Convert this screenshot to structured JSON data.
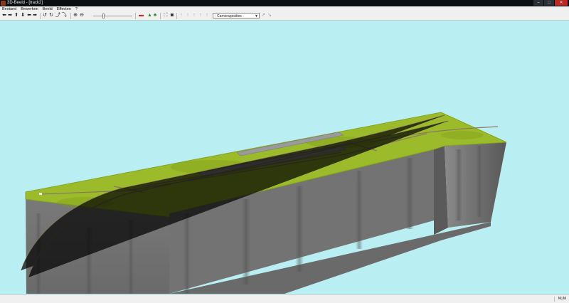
{
  "window": {
    "title": "3D-Beeld - [track2]",
    "minimize": "–",
    "maximize": "□",
    "close": "✕"
  },
  "menu": [
    "Bestand",
    "Bewerken",
    "Beeld",
    "Effecten",
    "?"
  ],
  "toolbar": {
    "camera_select": {
      "value": "- Cameraposities -"
    },
    "nav_icons": [
      "arrow-left-icon",
      "arrow-right-icon",
      "arrow-up-icon",
      "arrow-down-icon",
      "arrow-left-icon",
      "arrow-right-icon"
    ],
    "accent": "#2c8a2c"
  },
  "colors": {
    "sky": "#b9eef2",
    "grass": "#9cbb2a",
    "cliff": "#6e6e6e",
    "track": "#8a7a60"
  },
  "status": {
    "num": "NUM"
  }
}
